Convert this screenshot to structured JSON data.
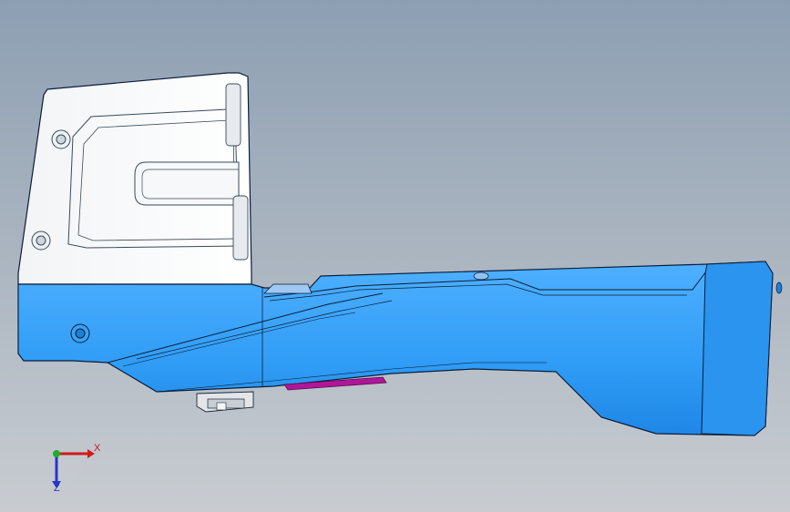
{
  "viewport": {
    "background_top": "#8d9fb3",
    "background_bottom": "#c8ccd1"
  },
  "part": {
    "upper_block_color": "#ffffff",
    "body_color": "#2f9cf5",
    "body_shade_color": "#1f86e6",
    "clip_color": "#b0169a",
    "edge_color": "#0b1d3a"
  },
  "triad": {
    "x_label": "X",
    "z_label": "Z",
    "x_color": "#d11a1a",
    "y_color": "#1fae2a",
    "z_color": "#2636c8"
  }
}
